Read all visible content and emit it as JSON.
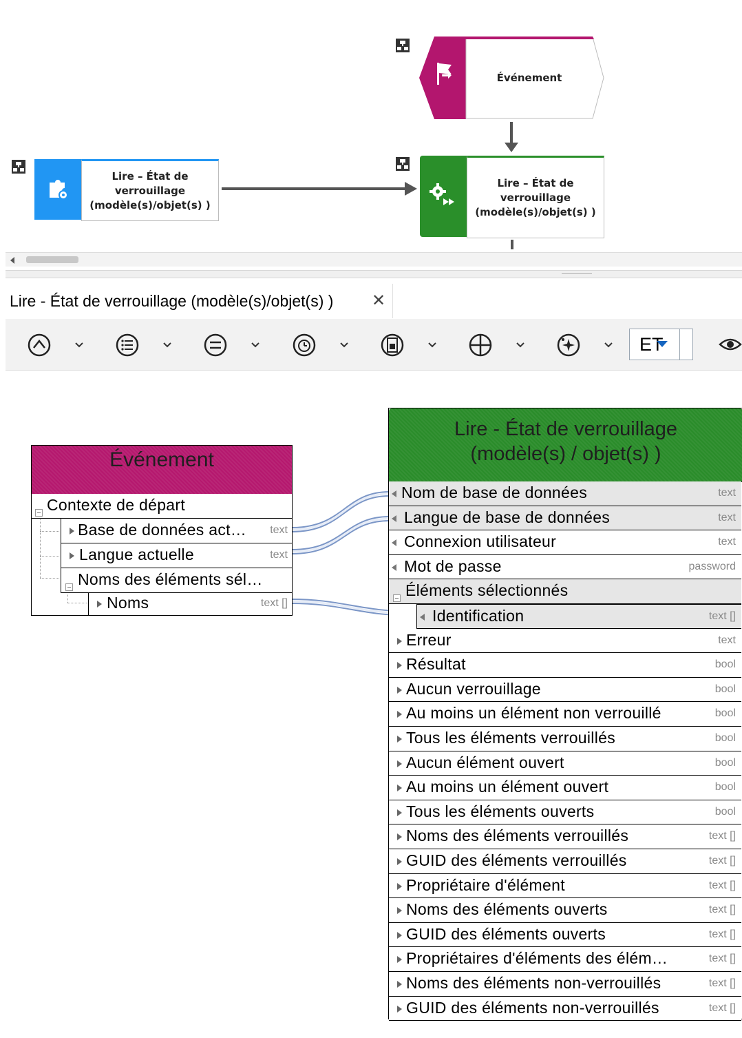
{
  "diagram": {
    "event_node": {
      "label": "Événement",
      "color": "#b3166e"
    },
    "function_node_left": {
      "label": "Lire – État de verrouillage (modèle(s)/objet(s) )",
      "color": "#2196f3"
    },
    "function_node_right": {
      "label": "Lire – État de verrouillage (modèle(s)/objet(s) )",
      "color": "#2a8f2a"
    }
  },
  "tab": {
    "title": "Lire - État de verrouillage (modèle(s)/objet(s) )",
    "close_glyph": "✕"
  },
  "toolbar": {
    "buttons": [
      "up-circle-icon",
      "list-circle-icon",
      "equals-circle-icon",
      "timer-circle-icon",
      "document-circle-icon",
      "crosshair-circle-icon",
      "sparkle-circle-icon",
      "eye-icon"
    ],
    "operator_select": {
      "value": "ET"
    }
  },
  "event_panel": {
    "title": "Événement",
    "color": "#b5186e",
    "rows": [
      {
        "label": "Contexte de départ",
        "type": ""
      },
      {
        "label": "Base de données act…",
        "type": "text"
      },
      {
        "label": "Langue actuelle",
        "type": "text"
      },
      {
        "label": "Noms des éléments sél…",
        "type": ""
      },
      {
        "label": "Noms",
        "type": "text []"
      }
    ]
  },
  "function_panel": {
    "title_line1": "Lire - État de verrouillage",
    "title_line2": "(modèle(s) / objet(s) )",
    "color": "#2a8c2a",
    "input_rows": [
      {
        "label": "Nom de base de données",
        "type": "text"
      },
      {
        "label": "Langue de base de données",
        "type": "text"
      },
      {
        "label": "Connexion utilisateur",
        "type": "text"
      },
      {
        "label": "Mot de passe",
        "type": "password"
      },
      {
        "label": "Éléments sélectionnés",
        "type": ""
      },
      {
        "label": "Identification",
        "type": "text []"
      }
    ],
    "output_rows": [
      {
        "label": "Erreur",
        "type": "text"
      },
      {
        "label": "Résultat",
        "type": "bool"
      },
      {
        "label": "Aucun verrouillage",
        "type": "bool"
      },
      {
        "label": "Au moins un élément non verrouillé",
        "type": "bool"
      },
      {
        "label": "Tous les éléments verrouillés",
        "type": "bool"
      },
      {
        "label": "Aucun élément ouvert",
        "type": "bool"
      },
      {
        "label": "Au moins un élément ouvert",
        "type": "bool"
      },
      {
        "label": "Tous les éléments ouverts",
        "type": "bool"
      },
      {
        "label": "Noms des éléments verrouillés",
        "type": "text []"
      },
      {
        "label": "GUID des éléments verrouillés",
        "type": "text []"
      },
      {
        "label": "Propriétaire d'élément",
        "type": "text []"
      },
      {
        "label": "Noms des éléments ouverts",
        "type": "text []"
      },
      {
        "label": "GUID des éléments ouverts",
        "type": "text []"
      },
      {
        "label": "Propriétaires d'éléments des élém…",
        "type": "text []"
      },
      {
        "label": "Noms des éléments non-verrouillés",
        "type": "text []"
      },
      {
        "label": "GUID des éléments non-verrouillés",
        "type": "text []"
      }
    ]
  }
}
